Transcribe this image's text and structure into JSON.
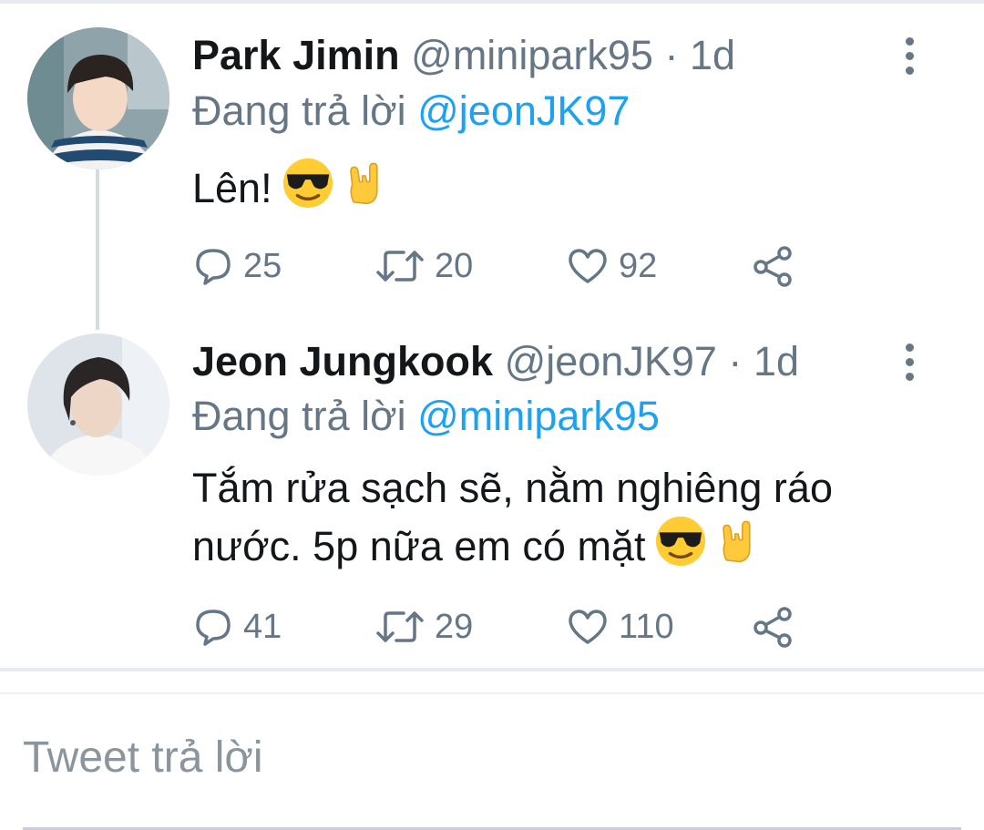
{
  "tweets": [
    {
      "name": "Park Jimin",
      "handle": "@minipark95",
      "separator": "·",
      "time": "1d",
      "replying_prefix": "Đang trả lời",
      "replying_to": "@jeonJK97",
      "text": "Lên!",
      "emojis": [
        "smiling-face-with-sunglasses",
        "sign-of-the-horns"
      ],
      "replies": "25",
      "retweets": "20",
      "likes": "92"
    },
    {
      "name": "Jeon Jungkook",
      "handle": "@jeonJK97",
      "separator": "·",
      "time": "1d",
      "replying_prefix": "Đang trả lời",
      "replying_to": "@minipark95",
      "text_line1": "Tắm rửa sạch sẽ, nằm nghiêng ráo",
      "text_line2": "nước. 5p nữa em có mặt",
      "emojis": [
        "smiling-face-with-sunglasses",
        "sign-of-the-horns"
      ],
      "replies": "41",
      "retweets": "29",
      "likes": "110"
    }
  ],
  "reply_box": {
    "placeholder": "Tweet trả lời"
  },
  "colors": {
    "link": "#1da1f2",
    "secondary_text": "#657786",
    "primary_text": "#14171a",
    "divider": "#e6ecf0"
  }
}
